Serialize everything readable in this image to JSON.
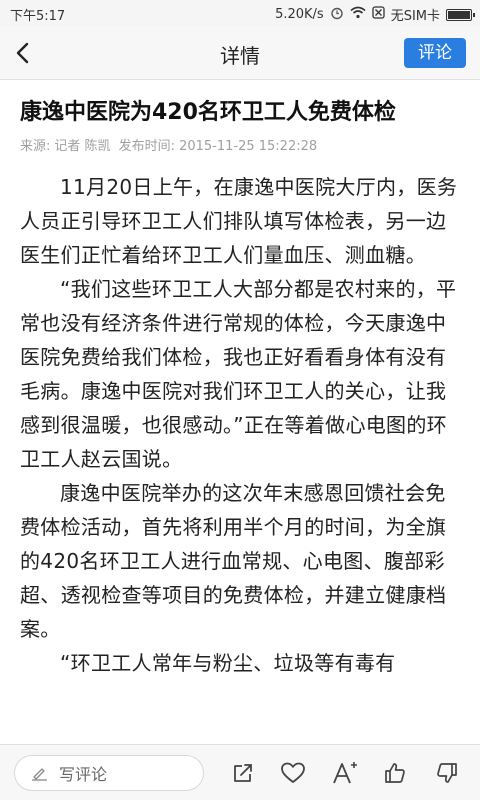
{
  "status_bar": {
    "time": "下午5:17",
    "network_speed": "5.20K/s",
    "sim": "无SIM卡"
  },
  "nav": {
    "title": "详情",
    "comment_button": "评论"
  },
  "article": {
    "title": "康逸中医院为420名环卫工人免费体检",
    "meta": {
      "source_label": "来源:",
      "reporter": "记者 陈凯",
      "publish_label": "发布时间:",
      "publish_time": "2015-11-25 15:22:28"
    },
    "paragraphs": [
      "11月20日上午，在康逸中医院大厅内，医务人员正引导环卫工人们排队填写体检表，另一边医生们正忙着给环卫工人们量血压、测血糖。",
      "“我们这些环卫工人大部分都是农村来的，平常也没有经济条件进行常规的体检，今天康逸中医院免费给我们体检，我也正好看看身体有没有毛病。康逸中医院对我们环卫工人的关心，让我感到很温暖，也很感动。”正在等着做心电图的环卫工人赵云国说。",
      "康逸中医院举办的这次年末感恩回馈社会免费体检活动，首先将利用半个月的时间，为全旗的420名环卫工人进行血常规、心电图、腹部彩超、透视检查等项目的免费体检，并建立健康档案。",
      "“环卫工人常年与粉尘、垃圾等有毒有"
    ]
  },
  "bottom_bar": {
    "comment_placeholder": "写评论",
    "icons": [
      "share-icon",
      "favorite-icon",
      "font-size-icon",
      "thumbs-up-icon",
      "thumbs-down-icon"
    ]
  }
}
